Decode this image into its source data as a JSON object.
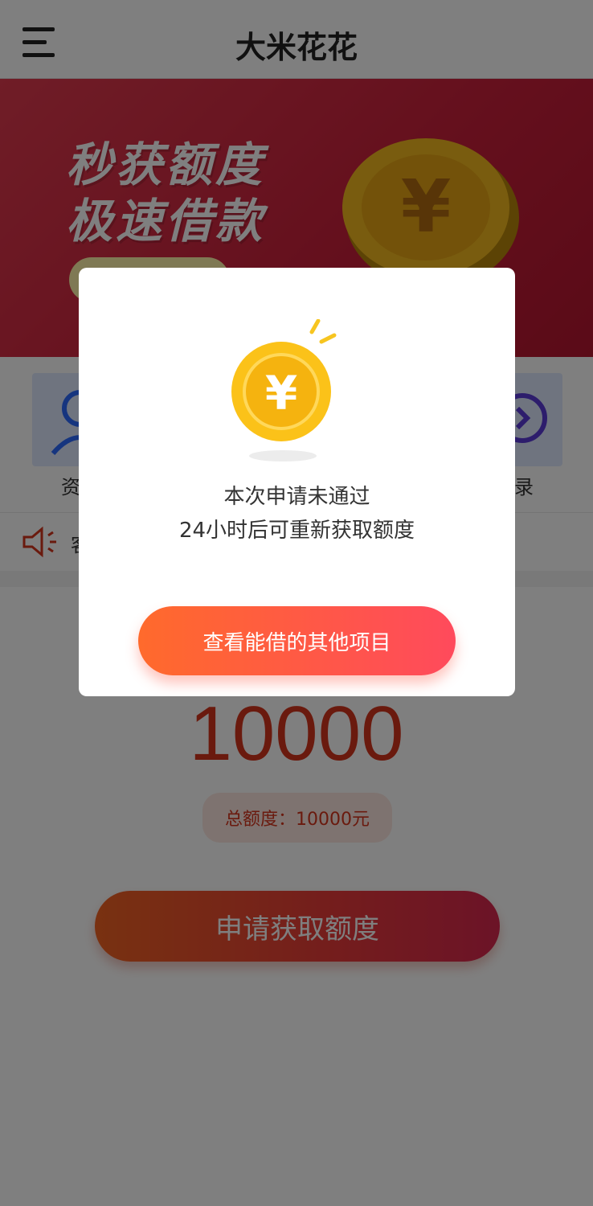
{
  "header": {
    "title": "大米花花",
    "menu_icon": "menu-icon"
  },
  "banner": {
    "line1": "秒获额度",
    "line2": "极速借款",
    "coin_icon": "yuan-coin-icon"
  },
  "quick": {
    "items": [
      {
        "label": "资料",
        "icon": "user-icon"
      },
      {
        "label": "记录",
        "icon": "record-icon"
      }
    ]
  },
  "notice": {
    "icon": "speaker-icon",
    "text": "客"
  },
  "main": {
    "amount": "10000",
    "total_label": "总额度：10000元",
    "apply_label": "申请获取额度"
  },
  "modal": {
    "coin_icon": "yuan-coin-icon",
    "line1": "本次申请未通过",
    "line2": "24小时后可重新获取额度",
    "button_label": "查看能借的其他项目"
  },
  "colors": {
    "accent": "#d4351c",
    "banner_red": "#d8283f",
    "button_orange": "#ff6a2c",
    "button_pink": "#ff4a5c"
  }
}
